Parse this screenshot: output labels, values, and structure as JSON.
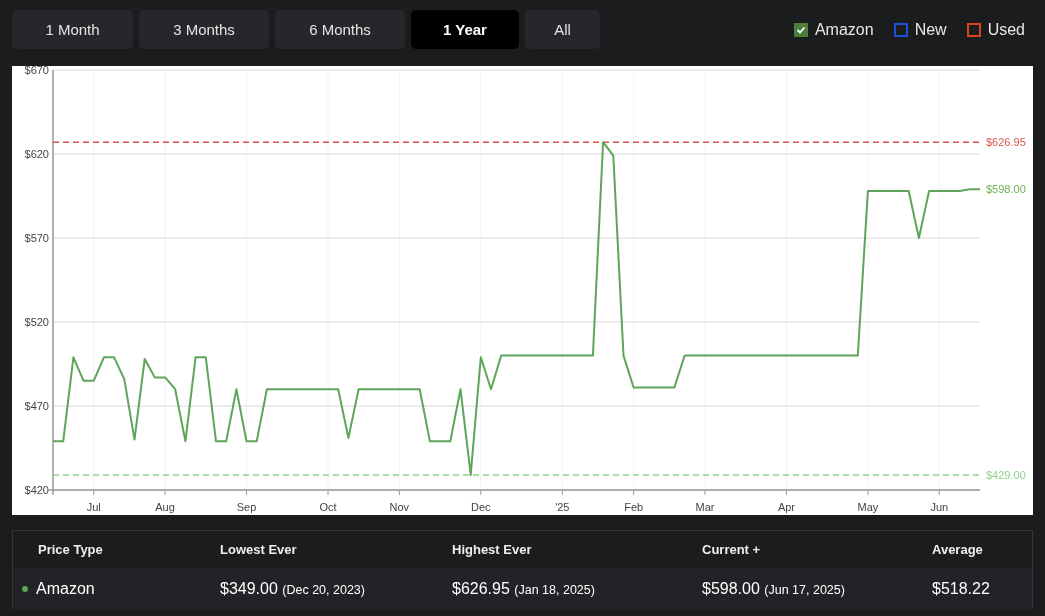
{
  "ranges": [
    {
      "label": "1 Month",
      "selected": false
    },
    {
      "label": "3 Months",
      "selected": false
    },
    {
      "label": "6 Months",
      "selected": false
    },
    {
      "label": "1 Year",
      "selected": true
    },
    {
      "label": "All",
      "selected": false
    }
  ],
  "legend": [
    {
      "label": "Amazon",
      "checked": true,
      "color": "#4c7f3c"
    },
    {
      "label": "New",
      "checked": false,
      "color": "#1e4fd8"
    },
    {
      "label": "Used",
      "checked": false,
      "color": "#d8441e"
    }
  ],
  "chart": {
    "current_label": {
      "label": "$598.00",
      "color": "#6ab04c"
    },
    "chart_data": {
      "type": "line",
      "grid": true,
      "ylim": [
        420,
        670
      ],
      "yticks": [
        {
          "value": 420,
          "label": "$420"
        },
        {
          "value": 470,
          "label": "$470"
        },
        {
          "value": 520,
          "label": "$520"
        },
        {
          "value": 570,
          "label": "$570"
        },
        {
          "value": 620,
          "label": "$620"
        },
        {
          "value": 670,
          "label": "$670"
        }
      ],
      "ref_lines": [
        {
          "axis": "y",
          "value": 626.95,
          "label": "$626.95",
          "color": "#d9534f"
        },
        {
          "axis": "y",
          "value": 429,
          "label": "$429.00",
          "color": "#8fd18a"
        }
      ],
      "categories": [
        null,
        null,
        null,
        null,
        "Jul",
        null,
        null,
        null,
        null,
        null,
        null,
        "Aug",
        null,
        null,
        null,
        null,
        null,
        null,
        null,
        "Sep",
        null,
        null,
        null,
        null,
        null,
        null,
        null,
        "Oct",
        null,
        null,
        null,
        null,
        null,
        null,
        "Nov",
        null,
        null,
        null,
        null,
        null,
        null,
        null,
        "Dec",
        null,
        null,
        null,
        null,
        null,
        null,
        null,
        "'25",
        null,
        null,
        null,
        null,
        null,
        null,
        "Feb",
        null,
        null,
        null,
        null,
        null,
        null,
        "Mar",
        null,
        null,
        null,
        null,
        null,
        null,
        null,
        "Apr",
        null,
        null,
        null,
        null,
        null,
        null,
        null,
        "May",
        null,
        null,
        null,
        null,
        null,
        null,
        "Jun",
        null,
        null,
        null,
        null
      ],
      "series": [
        {
          "color": "#5ea55a",
          "values": [
            449,
            449,
            499,
            485,
            485,
            499,
            499,
            486,
            450,
            498,
            487,
            487,
            480,
            449,
            499,
            499,
            449,
            449,
            480,
            449,
            449,
            480,
            480,
            480,
            480,
            480,
            480,
            480,
            480,
            451,
            480,
            480,
            480,
            480,
            480,
            480,
            480,
            449,
            449,
            449,
            480,
            429,
            499,
            480,
            500,
            500,
            500,
            500,
            500,
            500,
            500,
            500,
            500,
            500,
            627,
            619,
            500,
            481,
            481,
            481,
            481,
            481,
            500,
            500,
            500,
            500,
            500,
            500,
            500,
            500,
            500,
            500,
            500,
            500,
            500,
            500,
            500,
            500,
            500,
            500,
            598,
            598,
            598,
            598,
            598,
            570,
            598,
            598,
            598,
            598,
            599,
            599
          ]
        }
      ]
    }
  },
  "table": {
    "columns": [
      "Price Type",
      "Lowest Ever",
      "Highest Ever",
      "Current +",
      "Average"
    ],
    "rows": [
      {
        "color": "#5ea55a",
        "type": "Amazon",
        "lowest": {
          "price": "$349.00",
          "date": "(Dec 20, 2023)"
        },
        "highest": {
          "price": "$626.95",
          "date": "(Jan 18, 2025)"
        },
        "current": {
          "price": "$598.00",
          "date": "(Jun 17, 2025)"
        },
        "average": "$518.22"
      }
    ]
  }
}
